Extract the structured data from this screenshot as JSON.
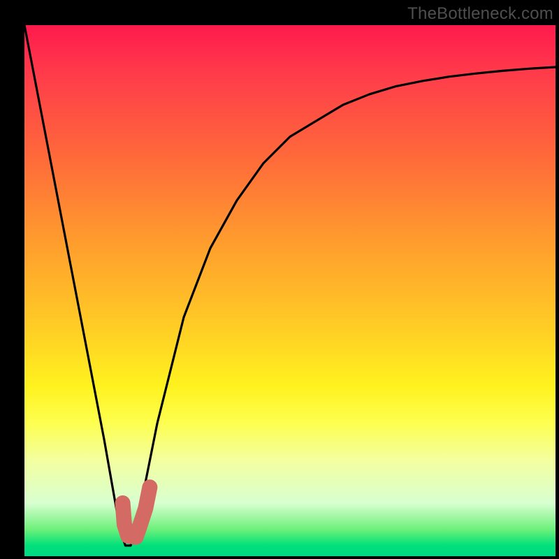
{
  "watermark": "TheBottleneck.com",
  "colors": {
    "background": "#000000",
    "curve": "#000000",
    "marker": "#d36a63",
    "gradient_top": "#ff1a4d",
    "gradient_bottom": "#00d884"
  },
  "chart_data": {
    "type": "line",
    "title": "",
    "xlabel": "",
    "ylabel": "",
    "xlim": [
      0,
      100
    ],
    "ylim": [
      0,
      100
    ],
    "grid": false,
    "legend": false,
    "series": [
      {
        "name": "bottleneck-curve",
        "x": [
          0,
          5,
          10,
          15,
          18,
          19,
          20,
          22,
          25,
          30,
          35,
          40,
          45,
          50,
          55,
          60,
          65,
          70,
          75,
          80,
          85,
          90,
          95,
          100
        ],
        "values": [
          100,
          74,
          48,
          22,
          5,
          2,
          2,
          10,
          25,
          45,
          58,
          67,
          74,
          79,
          82,
          85,
          87,
          88.5,
          89.5,
          90.3,
          90.9,
          91.4,
          91.8,
          92.1
        ]
      }
    ],
    "marker": {
      "name": "j-marker",
      "points_xy": [
        [
          18.5,
          10
        ],
        [
          18.8,
          6
        ],
        [
          19.5,
          3.8
        ],
        [
          21.0,
          3.6
        ],
        [
          21.5,
          5.0
        ],
        [
          22.8,
          9.0
        ],
        [
          23.6,
          13.0
        ]
      ]
    }
  }
}
